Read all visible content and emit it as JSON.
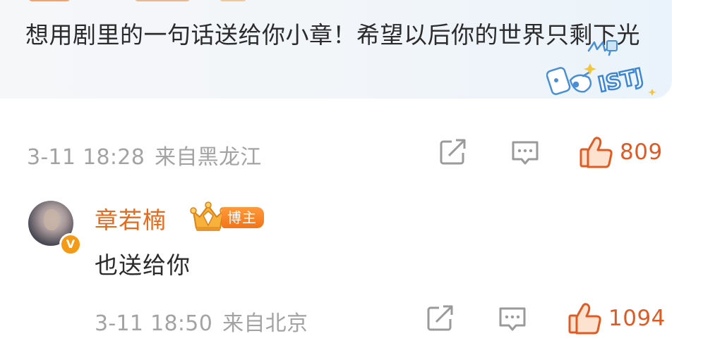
{
  "comment": {
    "text": "想用剧里的一句话送给你小章！希望以后你的世界只剩下光",
    "sticker_text": "ISTJ",
    "time": "3-11 18:28",
    "source": "来自黑龙江",
    "like_count": "809",
    "share_icon": "share-icon",
    "reply_icon": "comment-icon",
    "like_icon": "thumbs-up-icon"
  },
  "reply": {
    "username": "章若楠",
    "verified_badge": "V",
    "role_badge": "博主",
    "text": "也送给你",
    "time": "3-11 18:50",
    "source": "来自北京",
    "like_count": "1094"
  },
  "colors": {
    "accent": "#e66a1c",
    "like": "#e05b24",
    "meta": "#a3a3a3",
    "bubble": "#f3f5f8"
  }
}
